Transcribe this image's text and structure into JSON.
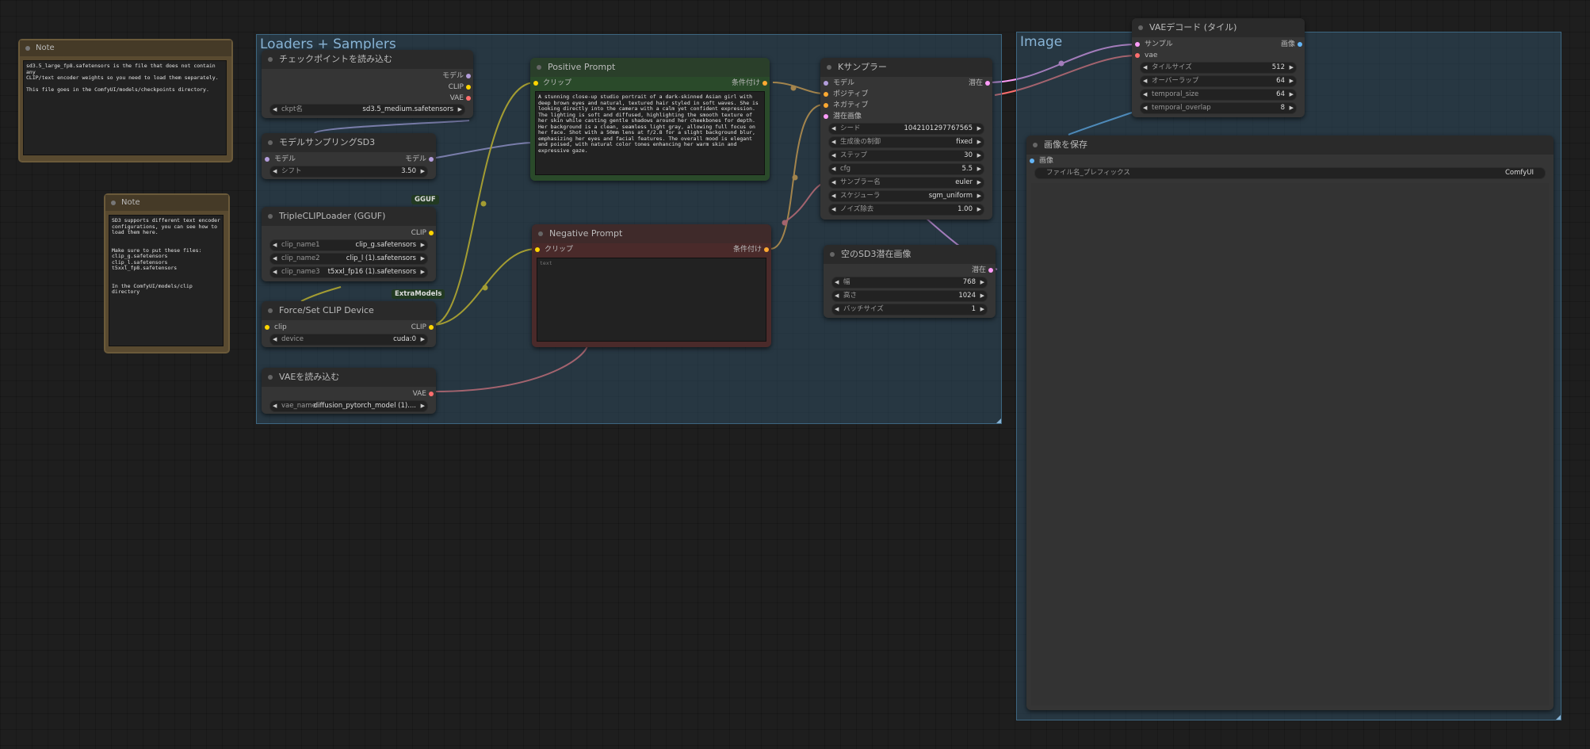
{
  "groups": {
    "loaders_samplers": "Loaders + Samplers",
    "image": "Image"
  },
  "notes": {
    "note1": {
      "title": "Note",
      "text": "sd3.5_large_fp8.safetensors is the file that does not contain any\nCLIP/text encoder weights so you need to load them separately.\n\nThis file goes in the ComfyUI/models/checkpoints directory."
    },
    "note2": {
      "title": "Note",
      "text": "SD3 supports different text encoder configurations, you can see how to load them here.\n\n\nMake sure to put these files:\nclip_g.safetensors\nclip_l.safetensors\nt5xxl_fp8.safetensors\n\n\nIn the ComfyUI/models/clip directory"
    }
  },
  "badges": {
    "gguf": "GGUF",
    "extra": "ExtraModels"
  },
  "checkpoint": {
    "title": "チェックポイントを読み込む",
    "outputs": [
      "モデル",
      "CLIP",
      "VAE"
    ],
    "widget_label": "ckpt名",
    "widget_value": "sd3.5_medium.safetensors"
  },
  "model_sampling": {
    "title": "モデルサンプリングSD3",
    "input": "モデル",
    "output": "モデル",
    "widget_label": "シフト",
    "widget_value": "3.50"
  },
  "triple_clip": {
    "title": "TripleCLIPLoader (GGUF)",
    "output": "CLIP",
    "widgets": [
      {
        "label": "clip_name1",
        "value": "clip_g.safetensors"
      },
      {
        "label": "clip_name2",
        "value": "clip_l (1).safetensors"
      },
      {
        "label": "clip_name3",
        "value": "t5xxl_fp16 (1).safetensors"
      }
    ]
  },
  "force_clip": {
    "title": "Force/Set CLIP Device",
    "input": "clip",
    "output": "CLIP",
    "widget_label": "device",
    "widget_value": "cuda:0"
  },
  "vae_loader": {
    "title": "VAEを読み込む",
    "output": "VAE",
    "widget_label": "vae_name",
    "widget_value": "diffusion_pytorch_model (1)...."
  },
  "positive": {
    "title": "Positive Prompt",
    "input": "クリップ",
    "output": "条件付け",
    "text": "A stunning close-up studio portrait of a dark-skinned Asian girl with deep brown eyes and natural, textured hair styled in soft waves. She is looking directly into the camera with a calm yet confident expression. The lighting is soft and diffused, highlighting the smooth texture of her skin while casting gentle shadows around her cheekbones for depth. Her background is a clean, seamless light gray, allowing full focus on her face. Shot with a 50mm lens at f/2.8 for a slight background blur, emphasizing her eyes and facial features. The overall mood is elegant and poised, with natural color tones enhancing her warm skin and expressive gaze."
  },
  "negative": {
    "title": "Negative Prompt",
    "input": "クリップ",
    "output": "条件付け",
    "placeholder": "text"
  },
  "ksampler": {
    "title": "Kサンプラー",
    "inputs": [
      "モデル",
      "ポジティブ",
      "ネガティブ",
      "潜在画像"
    ],
    "output": "潜在",
    "widgets": [
      {
        "label": "シード",
        "value": "1042101297767565"
      },
      {
        "label": "生成後の制御",
        "value": "fixed"
      },
      {
        "label": "ステップ",
        "value": "30"
      },
      {
        "label": "cfg",
        "value": "5.5"
      },
      {
        "label": "サンプラー名",
        "value": "euler"
      },
      {
        "label": "スケジューラ",
        "value": "sgm_uniform"
      },
      {
        "label": "ノイズ除去",
        "value": "1.00"
      }
    ]
  },
  "empty_latent": {
    "title": "空のSD3潜在画像",
    "output": "潜在",
    "widgets": [
      {
        "label": "幅",
        "value": "768"
      },
      {
        "label": "高さ",
        "value": "1024"
      },
      {
        "label": "バッチサイズ",
        "value": "1"
      }
    ]
  },
  "vae_decode": {
    "title": "VAEデコード (タイル)",
    "inputs": [
      "サンプル",
      "vae"
    ],
    "output": "画像",
    "widgets": [
      {
        "label": "タイルサイズ",
        "value": "512"
      },
      {
        "label": "オーバーラップ",
        "value": "64"
      },
      {
        "label": "temporal_size",
        "value": "64"
      },
      {
        "label": "temporal_overlap",
        "value": "8"
      }
    ]
  },
  "save_image": {
    "title": "画像を保存",
    "input": "画像",
    "widget_label": "ファイル名_プレフィックス",
    "widget_value": "ComfyUI"
  },
  "colors": {
    "model": "#b39ddb",
    "clip": "#ffd500",
    "vae": "#ff6e6e",
    "cond": "#ffa931",
    "latent": "#ff9cf9",
    "image": "#64b5f6",
    "pos_node": "#2a4a2a",
    "neg_node": "#4a2a2a"
  }
}
